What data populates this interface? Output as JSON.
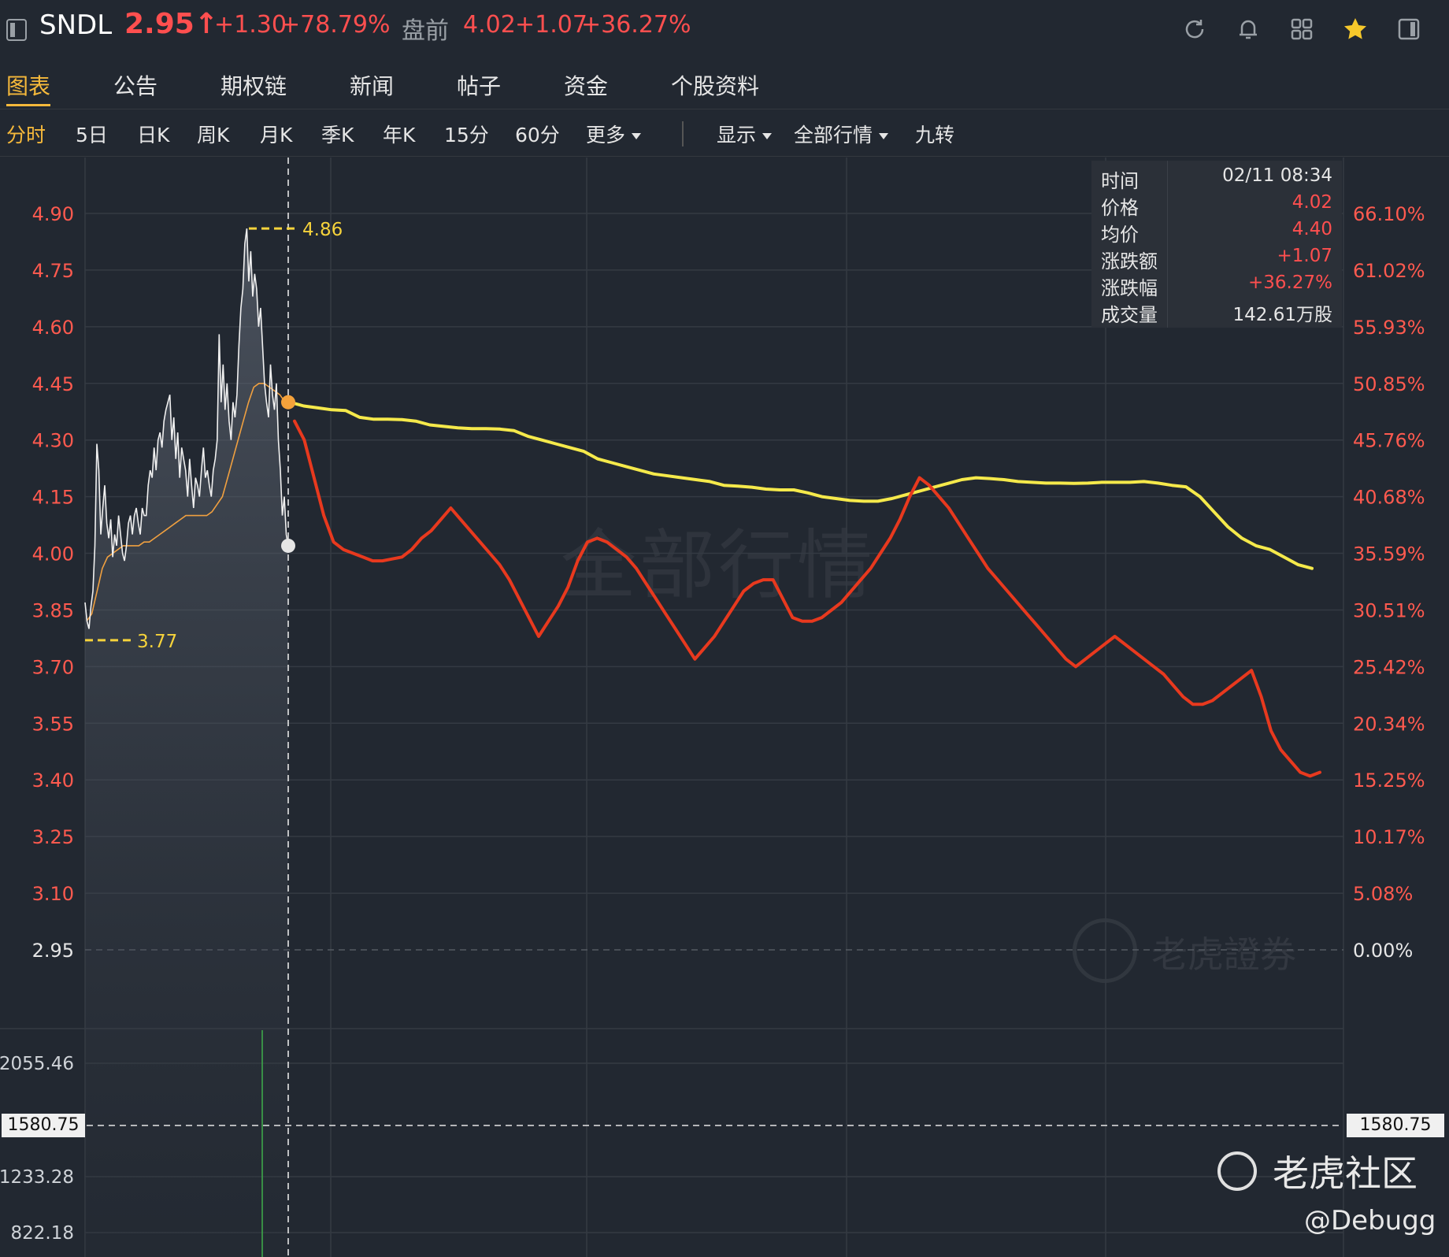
{
  "header": {
    "symbol": "SNDL",
    "price": "2.95↑",
    "change": "+1.30",
    "change_pct": "+78.79%",
    "premarket_label": "盘前",
    "premarket_price": "4.02",
    "premarket_change": "+1.07",
    "premarket_pct": "+36.27%",
    "icons": [
      "sidebar-toggle-icon",
      "refresh-icon",
      "bell-icon",
      "grid-icon",
      "star-icon",
      "panel-icon"
    ]
  },
  "tabs": [
    "图表",
    "公告",
    "期权链",
    "新闻",
    "帖子",
    "资金",
    "个股资料"
  ],
  "periods": [
    "分时",
    "5日",
    "日K",
    "周K",
    "月K",
    "季K",
    "年K",
    "15分",
    "60分",
    "更多"
  ],
  "toolbar": {
    "display": "显示",
    "market": "全部行情",
    "nine": "九转"
  },
  "info_panel": {
    "time_label": "时间",
    "time_value": "02/11 08:34",
    "price_label": "价格",
    "price_value": "4.02",
    "avg_label": "均价",
    "avg_value": "4.40",
    "chg_label": "涨跌额",
    "chg_value": "+1.07",
    "pct_label": "涨跌幅",
    "pct_value": "+36.27%",
    "vol_label": "成交量",
    "vol_value": "142.61万股"
  },
  "colors": {
    "up": "#ff4f4f",
    "accent": "#f6b93b",
    "yellow_line": "#f5e94b",
    "red_line": "#e8391e",
    "background": "#222831"
  },
  "watermarks": {
    "center": "全部行情",
    "brand": "老虎證券",
    "community": "老虎社区",
    "handle": "@Debugg"
  },
  "chart_data": {
    "type": "line",
    "y_ticks": [
      "4.90",
      "4.75",
      "4.60",
      "4.45",
      "4.30",
      "4.15",
      "4.00",
      "3.85",
      "3.70",
      "3.55",
      "3.40",
      "3.25",
      "3.10",
      "2.95"
    ],
    "y_pct_ticks": [
      "66.10%",
      "61.02%",
      "55.93%",
      "50.85%",
      "45.76%",
      "40.68%",
      "35.59%",
      "30.51%",
      "25.42%",
      "20.34%",
      "15.25%",
      "10.17%",
      "5.08%",
      "0.00%"
    ],
    "ylim": [
      2.95,
      4.9
    ],
    "prev_close": 2.95,
    "high_label": "4.86",
    "low_label": "3.77",
    "high": 4.86,
    "low": 3.77,
    "crosshair_price": 4.02,
    "crosshair_avg": 4.4,
    "volume_ticks": [
      "2055.46",
      "1580.75",
      "1233.28",
      "822.18"
    ],
    "volume_crosshair": "1580.75",
    "series": [
      {
        "role": "price_tick",
        "color": "#ffffff",
        "values": [
          3.87,
          3.82,
          3.8,
          3.86,
          3.9,
          4.02,
          4.29,
          4.22,
          4.05,
          4.12,
          4.18,
          4.08,
          4.04,
          4.09,
          3.99,
          4.05,
          4.02,
          4.1,
          4.05,
          4.0,
          3.98,
          4.02,
          4.08,
          4.1,
          4.05,
          4.1,
          4.12,
          4.08,
          4.05,
          4.12,
          4.1,
          4.1,
          4.18,
          4.22,
          4.2,
          4.28,
          4.22,
          4.3,
          4.32,
          4.28,
          4.35,
          4.38,
          4.4,
          4.42,
          4.3,
          4.36,
          4.25,
          4.32,
          4.2,
          4.28,
          4.25,
          4.22,
          4.15,
          4.25,
          4.18,
          4.12,
          4.2,
          4.18,
          4.15,
          4.22,
          4.28,
          4.2,
          4.22,
          4.18,
          4.15,
          4.22,
          4.25,
          4.3,
          4.58,
          4.4,
          4.5,
          4.38,
          4.45,
          4.35,
          4.3,
          4.4,
          4.36,
          4.42,
          4.55,
          4.65,
          4.7,
          4.82,
          4.86,
          4.72,
          4.8,
          4.68,
          4.74,
          4.7,
          4.6,
          4.65,
          4.55,
          4.45,
          4.4,
          4.36,
          4.5,
          4.42,
          4.38,
          4.45,
          4.3,
          4.22,
          4.1,
          4.15,
          4.05,
          4.02
        ]
      },
      {
        "role": "price_avg",
        "color": "#f0a040",
        "values": [
          3.82,
          3.84,
          3.9,
          3.96,
          3.99,
          4.0,
          4.01,
          4.02,
          4.02,
          4.02,
          4.02,
          4.03,
          4.03,
          4.04,
          4.05,
          4.06,
          4.07,
          4.08,
          4.09,
          4.1,
          4.1,
          4.1,
          4.1,
          4.1,
          4.11,
          4.13,
          4.15,
          4.2,
          4.25,
          4.3,
          4.35,
          4.4,
          4.44,
          4.45,
          4.45,
          4.44,
          4.43,
          4.42,
          4.4
        ]
      },
      {
        "role": "overlay_yellow",
        "color": "#f5e94b",
        "values": [
          4.4,
          4.39,
          4.385,
          4.38,
          4.378,
          4.36,
          4.355,
          4.355,
          4.354,
          4.35,
          4.34,
          4.336,
          4.332,
          4.33,
          4.33,
          4.329,
          4.325,
          4.31,
          4.3,
          4.29,
          4.28,
          4.27,
          4.25,
          4.24,
          4.23,
          4.22,
          4.21,
          4.205,
          4.2,
          4.195,
          4.19,
          4.18,
          4.178,
          4.175,
          4.17,
          4.168,
          4.168,
          4.16,
          4.15,
          4.145,
          4.14,
          4.138,
          4.138,
          4.145,
          4.155,
          4.165,
          4.175,
          4.185,
          4.195,
          4.2,
          4.198,
          4.195,
          4.19,
          4.188,
          4.186,
          4.186,
          4.185,
          4.186,
          4.188,
          4.188,
          4.188,
          4.19,
          4.186,
          4.18,
          4.176,
          4.15,
          4.11,
          4.07,
          4.04,
          4.02,
          4.01,
          3.99,
          3.97,
          3.96
        ]
      },
      {
        "role": "overlay_red",
        "color": "#e8391e",
        "values": [
          4.35,
          4.3,
          4.2,
          4.1,
          4.03,
          4.01,
          4.0,
          3.99,
          3.98,
          3.98,
          3.985,
          3.99,
          4.01,
          4.04,
          4.06,
          4.09,
          4.12,
          4.09,
          4.06,
          4.03,
          4.0,
          3.97,
          3.93,
          3.88,
          3.83,
          3.78,
          3.82,
          3.86,
          3.91,
          3.98,
          4.03,
          4.04,
          4.03,
          4.01,
          3.99,
          3.96,
          3.92,
          3.88,
          3.84,
          3.8,
          3.76,
          3.72,
          3.75,
          3.78,
          3.82,
          3.86,
          3.9,
          3.92,
          3.93,
          3.93,
          3.88,
          3.83,
          3.82,
          3.82,
          3.83,
          3.85,
          3.87,
          3.9,
          3.93,
          3.96,
          4.0,
          4.04,
          4.09,
          4.15,
          4.2,
          4.18,
          4.15,
          4.12,
          4.08,
          4.04,
          4.0,
          3.96,
          3.93,
          3.9,
          3.87,
          3.84,
          3.81,
          3.78,
          3.75,
          3.72,
          3.7,
          3.72,
          3.74,
          3.76,
          3.78,
          3.76,
          3.74,
          3.72,
          3.7,
          3.68,
          3.65,
          3.62,
          3.6,
          3.6,
          3.61,
          3.63,
          3.65,
          3.67,
          3.69,
          3.62,
          3.53,
          3.48,
          3.45,
          3.42,
          3.41,
          3.42
        ]
      }
    ]
  }
}
